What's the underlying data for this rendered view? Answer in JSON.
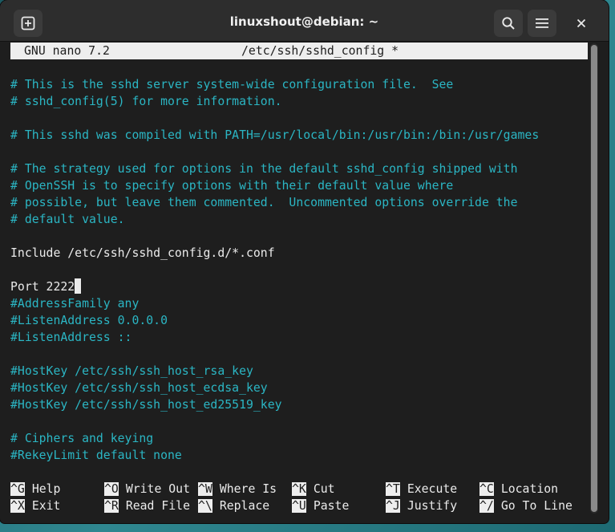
{
  "window": {
    "title": "linuxshout@debian: ~",
    "icons": [
      "new-tab-icon",
      "search-icon",
      "hamburger-menu-icon",
      "close-icon"
    ]
  },
  "nano": {
    "version_label": "GNU nano 7.2",
    "file_label": "/etc/ssh/sshd_config *"
  },
  "lines": [
    {
      "text": "",
      "comment": false
    },
    {
      "text": "# This is the sshd server system-wide configuration file.  See",
      "comment": true
    },
    {
      "text": "# sshd_config(5) for more information.",
      "comment": true
    },
    {
      "text": "",
      "comment": false
    },
    {
      "text": "# This sshd was compiled with PATH=/usr/local/bin:/usr/bin:/bin:/usr/games",
      "comment": true
    },
    {
      "text": "",
      "comment": false
    },
    {
      "text": "# The strategy used for options in the default sshd_config shipped with",
      "comment": true
    },
    {
      "text": "# OpenSSH is to specify options with their default value where",
      "comment": true
    },
    {
      "text": "# possible, but leave them commented.  Uncommented options override the",
      "comment": true
    },
    {
      "text": "# default value.",
      "comment": true
    },
    {
      "text": "",
      "comment": false
    },
    {
      "text": "Include /etc/ssh/sshd_config.d/*.conf",
      "comment": false
    },
    {
      "text": "",
      "comment": false
    },
    {
      "text": "Port 2222",
      "comment": false,
      "cursor": true
    },
    {
      "text": "#AddressFamily any",
      "comment": true
    },
    {
      "text": "#ListenAddress 0.0.0.0",
      "comment": true
    },
    {
      "text": "#ListenAddress ::",
      "comment": true
    },
    {
      "text": "",
      "comment": false
    },
    {
      "text": "#HostKey /etc/ssh/ssh_host_rsa_key",
      "comment": true
    },
    {
      "text": "#HostKey /etc/ssh/ssh_host_ecdsa_key",
      "comment": true
    },
    {
      "text": "#HostKey /etc/ssh/ssh_host_ed25519_key",
      "comment": true
    },
    {
      "text": "",
      "comment": false
    },
    {
      "text": "# Ciphers and keying",
      "comment": true
    },
    {
      "text": "#RekeyLimit default none",
      "comment": true
    }
  ],
  "shortcuts": {
    "row1": [
      {
        "key": "^G",
        "label": "Help"
      },
      {
        "key": "^O",
        "label": "Write Out"
      },
      {
        "key": "^W",
        "label": "Where Is"
      },
      {
        "key": "^K",
        "label": "Cut"
      },
      {
        "key": "^T",
        "label": "Execute"
      },
      {
        "key": "^C",
        "label": "Location"
      }
    ],
    "row2": [
      {
        "key": "^X",
        "label": "Exit"
      },
      {
        "key": "^R",
        "label": "Read File"
      },
      {
        "key": "^\\",
        "label": "Replace"
      },
      {
        "key": "^U",
        "label": "Paste"
      },
      {
        "key": "^J",
        "label": "Justify"
      },
      {
        "key": "^/",
        "label": "Go To Line"
      }
    ]
  }
}
